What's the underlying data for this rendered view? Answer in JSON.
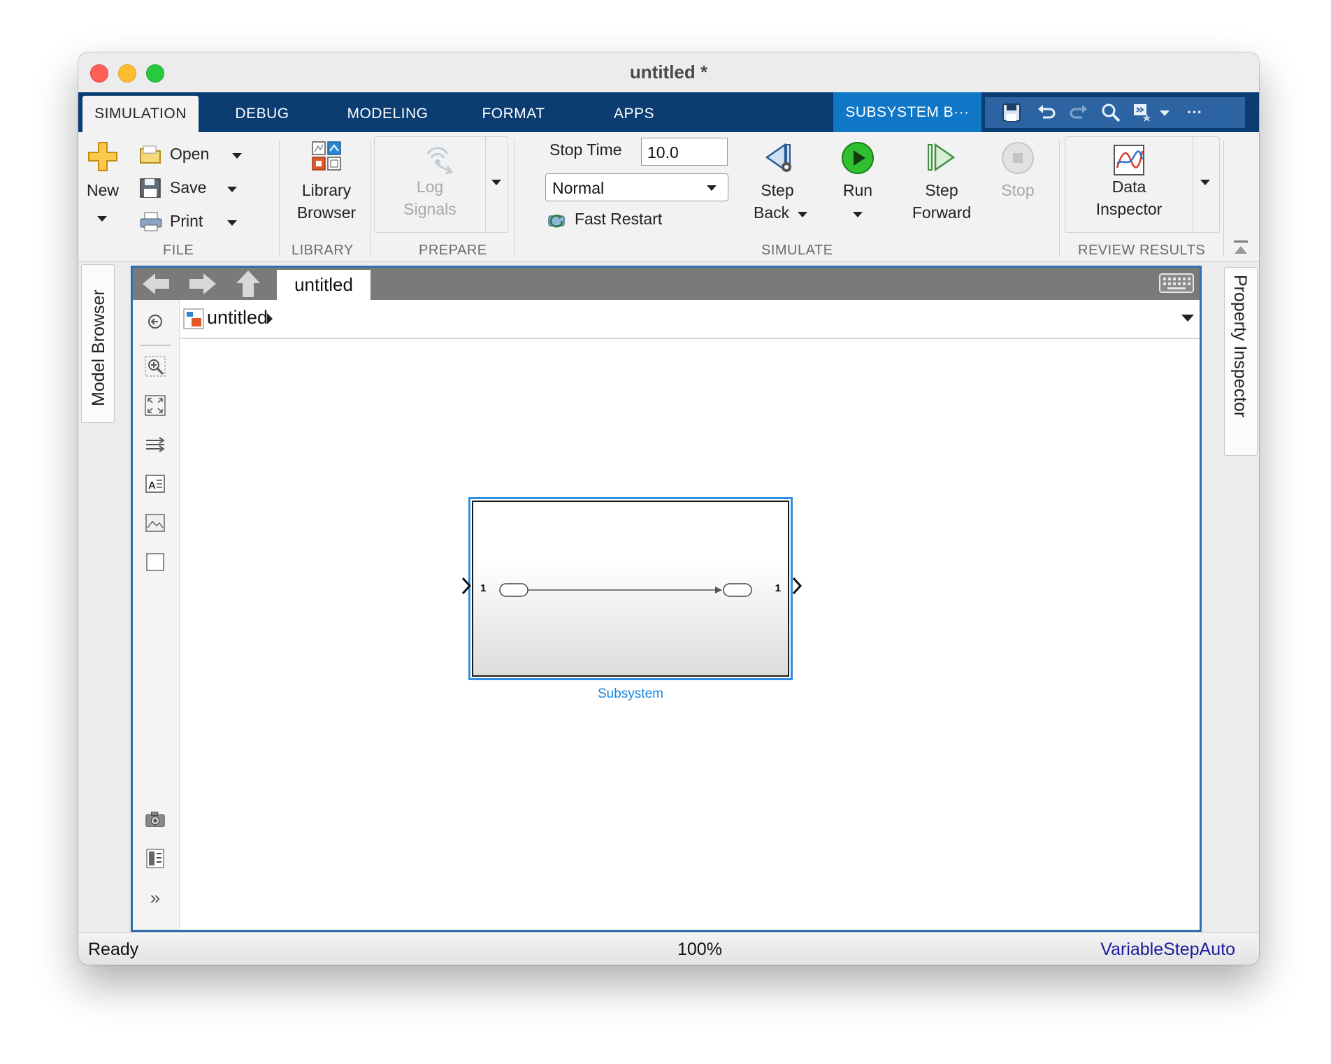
{
  "window": {
    "title": "untitled *"
  },
  "tabs": [
    {
      "label": "SIMULATION"
    },
    {
      "label": "DEBUG"
    },
    {
      "label": "MODELING"
    },
    {
      "label": "FORMAT"
    },
    {
      "label": "APPS"
    },
    {
      "label": "SUBSYSTEM B···"
    }
  ],
  "quick_access": [
    "save-icon",
    "undo-icon",
    "redo-icon",
    "find-icon",
    "shortcut-icon",
    "more-icon"
  ],
  "ribbon": {
    "file": {
      "group_label": "FILE",
      "new_label": "New",
      "open_label": "Open",
      "save_label": "Save",
      "print_label": "Print"
    },
    "library": {
      "group_label": "LIBRARY",
      "line1": "Library",
      "line2": "Browser"
    },
    "prepare": {
      "group_label": "PREPARE",
      "line1": "Log",
      "line2": "Signals"
    },
    "simulate": {
      "group_label": "SIMULATE",
      "stop_time_label": "Stop Time",
      "stop_time_value": "10.0",
      "mode_value": "Normal",
      "fast_restart_label": "Fast Restart",
      "step_back_line1": "Step",
      "step_back_line2": "Back",
      "run_label": "Run",
      "step_forward_line1": "Step",
      "step_forward_line2": "Forward",
      "stop_label": "Stop"
    },
    "review": {
      "group_label": "REVIEW RESULTS",
      "line1": "Data",
      "line2": "Inspector"
    }
  },
  "side_panels": {
    "left": "Model Browser",
    "right": "Property Inspector"
  },
  "editor": {
    "tab_title": "untitled",
    "breadcrumb": "untitled",
    "block": {
      "name": "Subsystem",
      "in_port": "1",
      "out_port": "1"
    }
  },
  "status": {
    "state": "Ready",
    "zoom": "100%",
    "solver": "VariableStepAuto"
  },
  "colors": {
    "tabbar": "#0b3d73",
    "context_tab": "#0f77c6",
    "selection": "#2f8fe0",
    "solver_text": "#1a1aa0",
    "run_green": "#2fbf30"
  }
}
